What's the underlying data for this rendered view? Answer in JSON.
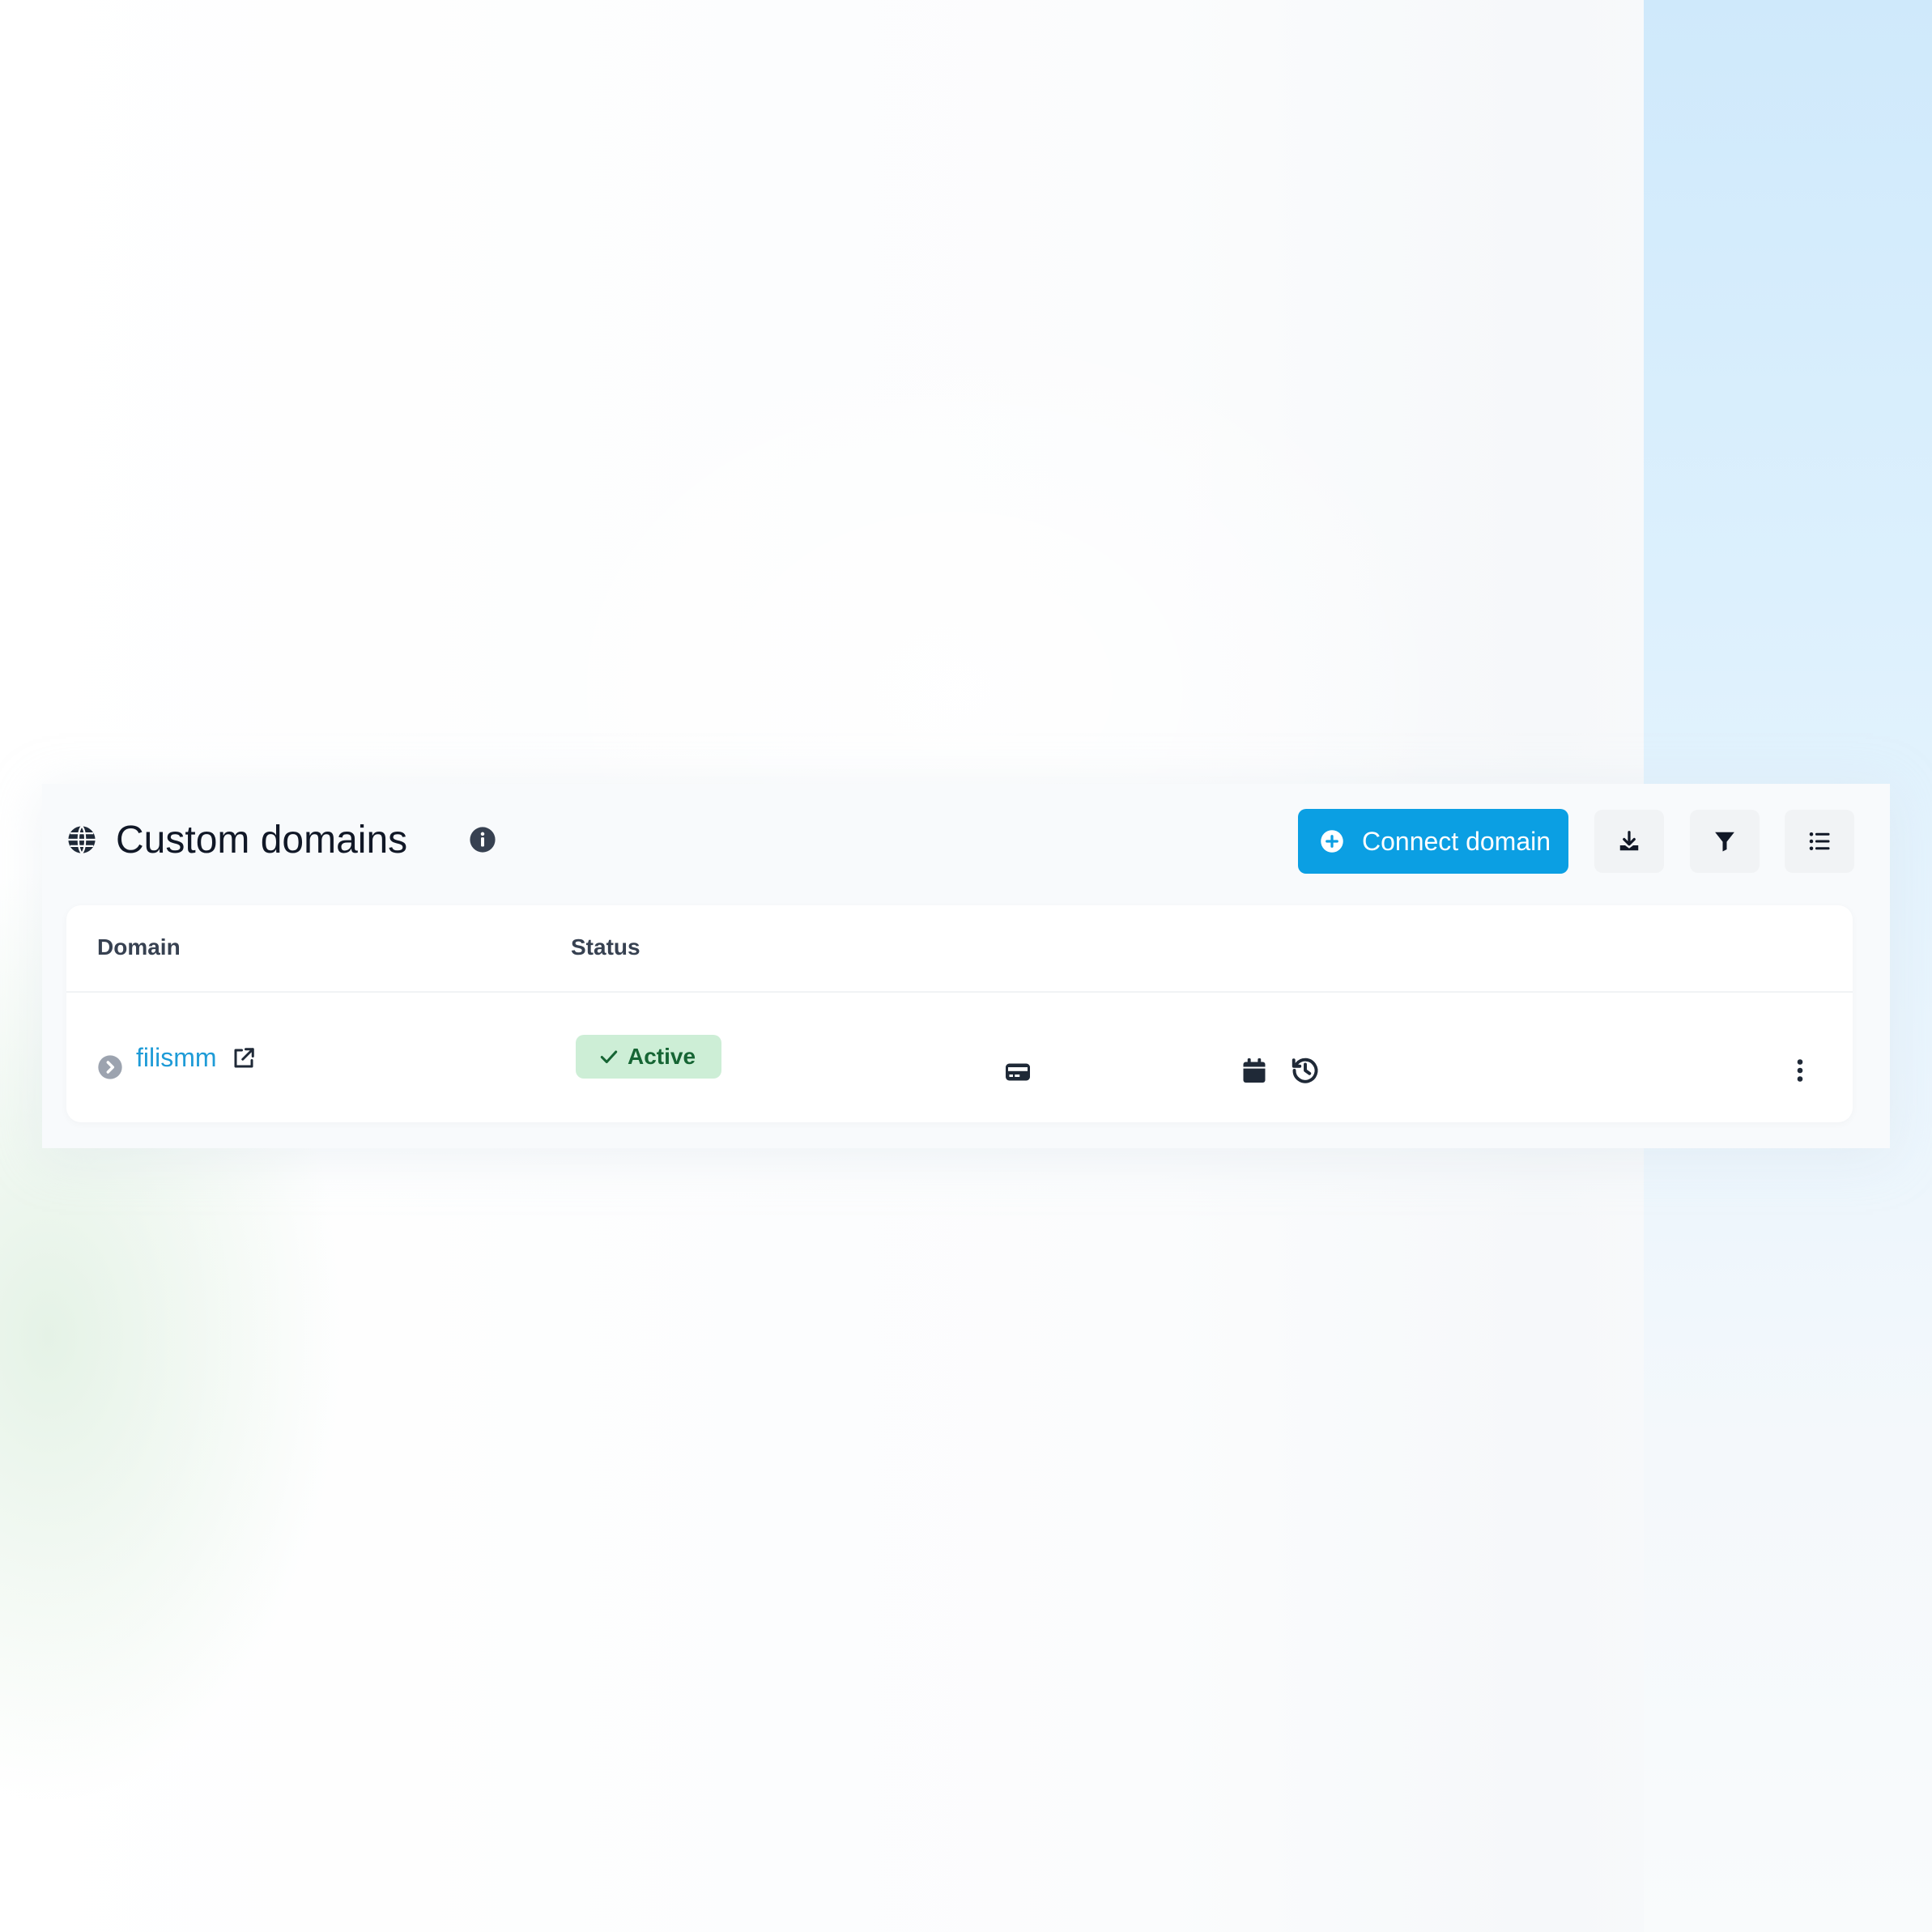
{
  "header": {
    "title": "Custom domains",
    "connect_button_label": "Connect domain"
  },
  "table": {
    "columns": [
      "Domain",
      "Status"
    ],
    "rows": [
      {
        "domain": "filismm",
        "status": "Active"
      }
    ]
  },
  "icons": {
    "title_icon": "globe-icon",
    "info": "info-icon",
    "connect": "plus-circle-icon",
    "download": "download-icon",
    "filter": "filter-icon",
    "columns": "list-icon",
    "expand": "chevron-right-circle-icon",
    "external": "external-link-icon",
    "status": "check-icon",
    "row_actions": [
      "credit-card-icon",
      "calendar-icon",
      "history-icon",
      "more-vertical-icon"
    ]
  },
  "colors": {
    "primary": "#0b9fe3",
    "link": "#1e9bd7",
    "success_bg": "#cdeed6",
    "success_text": "#166534",
    "title_text": "#111827"
  }
}
